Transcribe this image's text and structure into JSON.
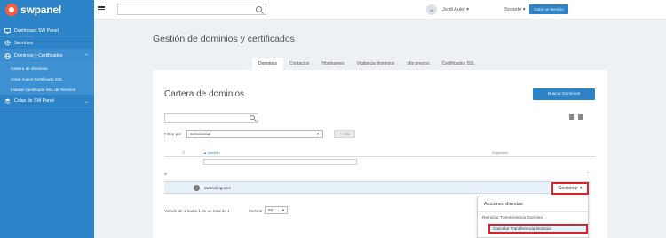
{
  "brand": {
    "name": "swpanel"
  },
  "sidebar": {
    "items": [
      {
        "label": "Dashboard SW Panel",
        "icon": "monitor-icon"
      },
      {
        "label": "Servicios",
        "icon": "gear-icon"
      },
      {
        "label": "Dominios y Certificados",
        "icon": "globe-icon"
      }
    ],
    "subitems": [
      {
        "label": "Cartera de dominios"
      },
      {
        "label": "Crear nuevo Certificado SSL"
      },
      {
        "label": "Instalar Certificado SSL de Terceros"
      }
    ],
    "extra": {
      "label": "Colas de SW Panel",
      "icon": "layers-icon"
    }
  },
  "topbar": {
    "avatar_initials": "JA",
    "user_name": "Jordi Aulet",
    "support_label": "Soporte",
    "create_service_label": "Crear un Servicio"
  },
  "main": {
    "page_title": "Gestión de dominios y certificados",
    "tabs": [
      {
        "label": "Dominios",
        "active": true
      },
      {
        "label": "Contactos"
      },
      {
        "label": "Hostnames"
      },
      {
        "label": "Vigilancia dominios"
      },
      {
        "label": "Mis precios"
      },
      {
        "label": "Certificados SSL"
      }
    ]
  },
  "card": {
    "title": "Cartera de dominios",
    "search_button": "Buscar Dominios",
    "filter_label": "Filtrar por",
    "filter_value": "Seleccionar",
    "info_button": "+ Info",
    "columns": {
      "expand": "⇕",
      "domain": "▲ dominio",
      "security": "Seguridad"
    },
    "group_label": "S",
    "rows": [
      {
        "domain": "swhosting.com"
      }
    ],
    "manage_button": "Gestionar",
    "footer_info": "Viendo de 1 hasta 1 de un total de 1",
    "footer_show": "Mostrar",
    "page_size": "50"
  },
  "dropdown": {
    "title": "Acciones directas",
    "items": [
      {
        "label": "Reiniciar Transferencia Dominio"
      },
      {
        "label": "Cancelar Transferencia Dominio"
      }
    ]
  },
  "colors": {
    "primary": "#2d83c7",
    "highlight": "#d8232a",
    "logo_accent": "#ff5a3c"
  }
}
